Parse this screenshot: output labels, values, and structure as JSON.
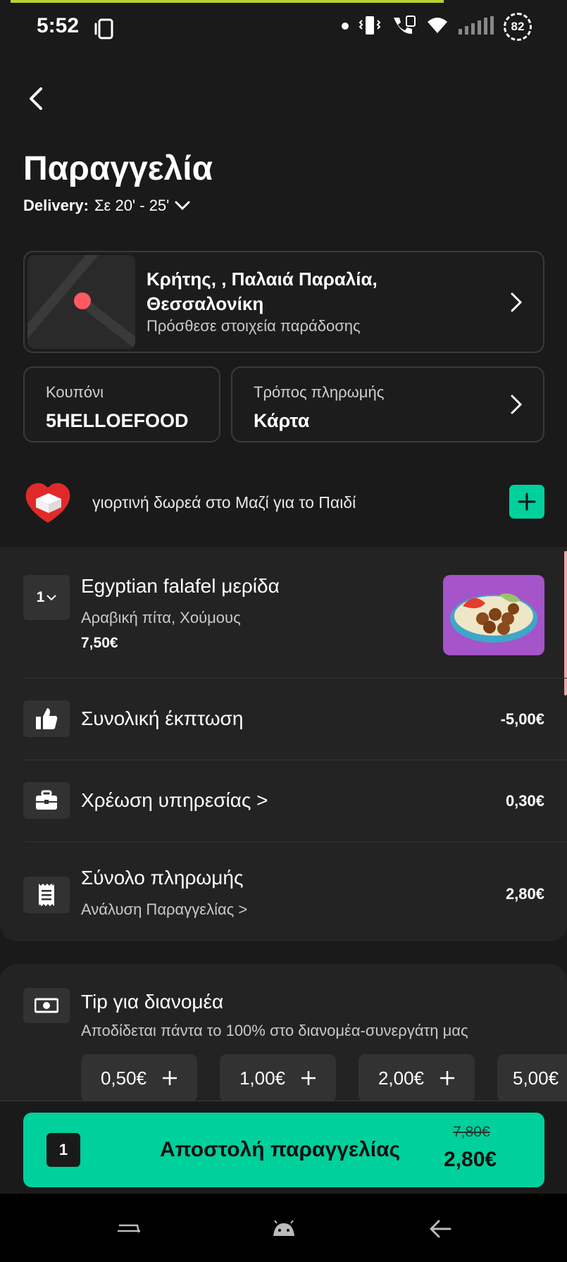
{
  "status_bar": {
    "time": "5:52",
    "battery": "82",
    "icons": [
      "screen-rotate-icon",
      "dot-icon",
      "vibrate-icon",
      "wifi-call-icon",
      "wifi-icon",
      "signal-icon",
      "battery-icon"
    ]
  },
  "header": {
    "back_icon": "chevron-left-icon",
    "title": "Παραγγελία",
    "delivery_label": "Delivery:",
    "delivery_time": "Σε 20' - 25'"
  },
  "address": {
    "street": "Κρήτης, , Παλαιά Παραλία,",
    "city": "Θεσσαλονίκη",
    "hint": "Πρόσθεσε στοιχεία παράδοσης"
  },
  "coupon": {
    "label": "Κουπόνι",
    "value": "5HELLOEFOOD"
  },
  "payment": {
    "label": "Τρόπος πληρωμής",
    "value": "Κάρτα"
  },
  "donation": {
    "text": "γιορτινή δωρεά στο Μαζί για το Παιδί",
    "accent": "#00d09c"
  },
  "cart": {
    "items": [
      {
        "qty": "1",
        "name": "Egyptian falafel μερίδα",
        "options": "Αραβική πίτα, Χούμους",
        "price": "7,50€"
      }
    ]
  },
  "summary": {
    "discount_label": "Συνολική έκπτωση",
    "discount_value": "-5,00€",
    "service_label": "Χρέωση υπηρεσίας >",
    "service_value": "0,30€",
    "total_label": "Σύνολο πληρωμής",
    "total_sub": "Ανάλυση Παραγγελίας >",
    "total_value": "2,80€"
  },
  "tip": {
    "title": "Tip για διανομέα",
    "subtitle": "Αποδίδεται πάντα το 100% στο διανομέα-συνεργάτη μας",
    "options": [
      "0,50€",
      "1,00€",
      "2,00€",
      "5,00€"
    ]
  },
  "submit": {
    "count": "1",
    "label": "Αποστολή παραγγελίας",
    "old_price": "7,80€",
    "new_price": "2,80€",
    "color": "#00d09c"
  }
}
